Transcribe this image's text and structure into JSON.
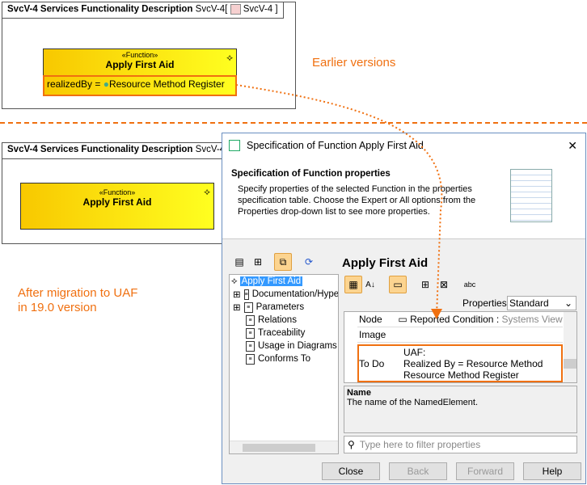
{
  "top_diagram": {
    "title": "SvcV-4 Services Functionality Description",
    "kind": "SvcV-4",
    "bracket_open": "[",
    "ref": "SvcV-4",
    "bracket_close": "]",
    "function": {
      "stereotype": "«Function»",
      "name": "Apply First Aid",
      "property": "realizedBy = ",
      "property_value": "Resource Method Register"
    }
  },
  "label_earlier": "Earlier versions",
  "bottom_diagram": {
    "title": "SvcV-4 Services Functionality Description",
    "kind": "SvcV-4",
    "function": {
      "stereotype": "«Function»",
      "name": "Apply First Aid"
    }
  },
  "label_after": [
    "After migration to UAF",
    "in 19.0 version"
  ],
  "dialog": {
    "title": "Specification of Function Apply First Aid",
    "close": "✕",
    "header_title": "Specification of Function properties",
    "header_desc": "Specify properties of the selected Function in the properties specification table. Choose the Expert or All options from the Properties drop-down list to see more properties.",
    "tree": [
      "Apply First Aid",
      "Documentation/Hyperlinks",
      "Parameters",
      "Relations",
      "Traceability",
      "Usage in Diagrams",
      "Conforms To"
    ],
    "element_title": "Apply First Aid",
    "properties_label": "Properties:",
    "properties_value": "Standard",
    "rows": [
      {
        "name": "Node",
        "value": "Reported Condition : ",
        "value_extra": "Systems Viewpoint"
      },
      {
        "name": "Image",
        "value": ""
      },
      {
        "name": "To Do",
        "value_lines": [
          "UAF:",
          "Realized By = Resource Method",
          "Resource Method Register"
        ]
      }
    ],
    "desc_title": "Name",
    "desc_text": "The name of the NamedElement.",
    "filter_placeholder": "Type here to filter properties",
    "buttons": {
      "close": "Close",
      "back": "Back",
      "forward": "Forward",
      "help": "Help"
    }
  },
  "colors": {
    "accent": "#f07010",
    "selection": "#3399ff"
  }
}
